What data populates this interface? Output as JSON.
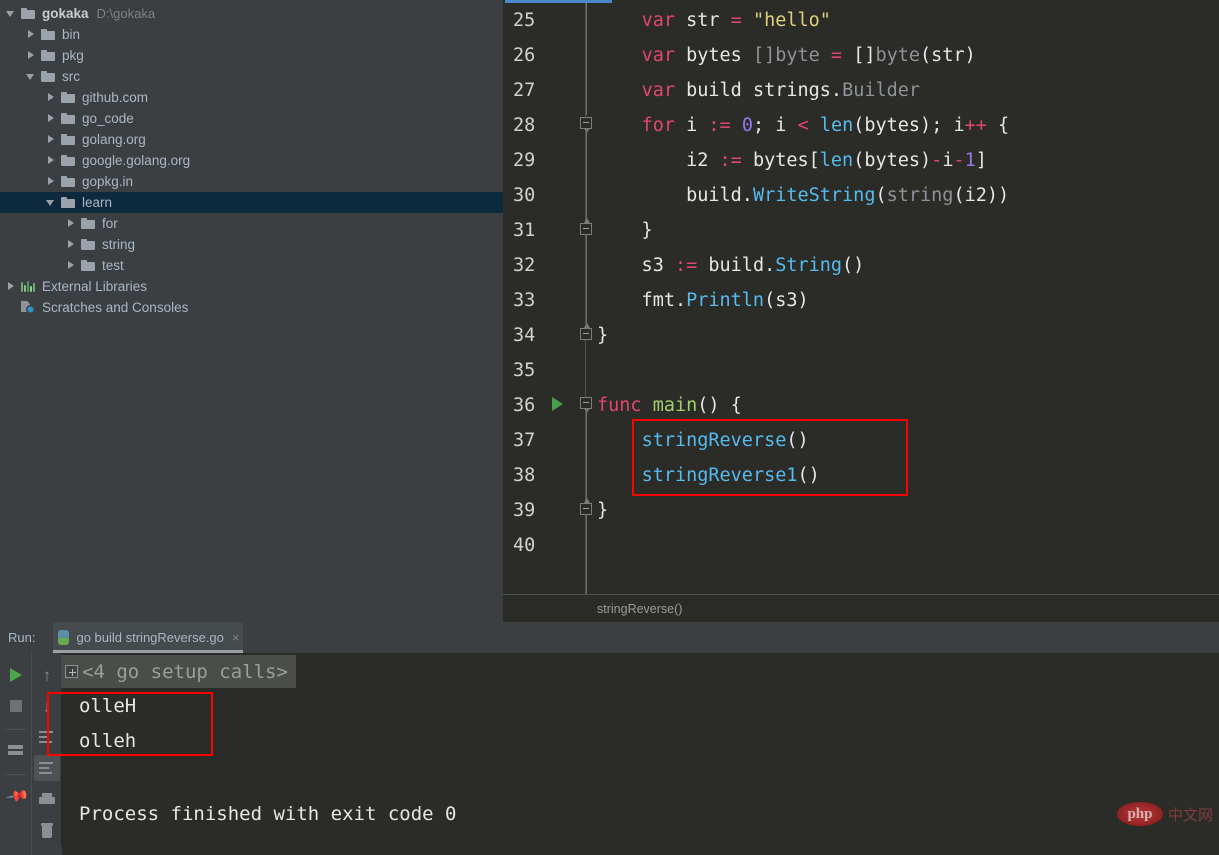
{
  "project_tree": {
    "items": [
      {
        "label": "gokaka",
        "path": "D:\\gokaka",
        "indent": 0,
        "arrow": "down",
        "icon": "folder-icon",
        "bold": true,
        "selected": false
      },
      {
        "label": "bin",
        "path": "",
        "indent": 1,
        "arrow": "right",
        "icon": "folder-icon",
        "bold": false,
        "selected": false
      },
      {
        "label": "pkg",
        "path": "",
        "indent": 1,
        "arrow": "right",
        "icon": "folder-icon",
        "bold": false,
        "selected": false
      },
      {
        "label": "src",
        "path": "",
        "indent": 1,
        "arrow": "down",
        "icon": "folder-icon",
        "bold": false,
        "selected": false
      },
      {
        "label": "github.com",
        "path": "",
        "indent": 2,
        "arrow": "right",
        "icon": "folder-icon",
        "bold": false,
        "selected": false
      },
      {
        "label": "go_code",
        "path": "",
        "indent": 2,
        "arrow": "right",
        "icon": "folder-icon",
        "bold": false,
        "selected": false
      },
      {
        "label": "golang.org",
        "path": "",
        "indent": 2,
        "arrow": "right",
        "icon": "folder-icon",
        "bold": false,
        "selected": false
      },
      {
        "label": "google.golang.org",
        "path": "",
        "indent": 2,
        "arrow": "right",
        "icon": "folder-icon",
        "bold": false,
        "selected": false
      },
      {
        "label": "gopkg.in",
        "path": "",
        "indent": 2,
        "arrow": "right",
        "icon": "folder-icon",
        "bold": false,
        "selected": false
      },
      {
        "label": "learn",
        "path": "",
        "indent": 2,
        "arrow": "down",
        "icon": "folder-icon",
        "bold": false,
        "selected": true
      },
      {
        "label": "for",
        "path": "",
        "indent": 3,
        "arrow": "right",
        "icon": "folder-icon",
        "bold": false,
        "selected": false
      },
      {
        "label": "string",
        "path": "",
        "indent": 3,
        "arrow": "right",
        "icon": "folder-icon",
        "bold": false,
        "selected": false
      },
      {
        "label": "test",
        "path": "",
        "indent": 3,
        "arrow": "right",
        "icon": "folder-icon",
        "bold": false,
        "selected": false
      },
      {
        "label": "External Libraries",
        "path": "",
        "indent": 0,
        "arrow": "right",
        "icon": "library-icon",
        "bold": false,
        "selected": false
      },
      {
        "label": "Scratches and Consoles",
        "path": "",
        "indent": 0,
        "arrow": "none",
        "icon": "scratches-icon",
        "bold": false,
        "selected": false
      }
    ]
  },
  "editor": {
    "breadcrumb": "stringReverse()",
    "lines": [
      {
        "num": "25",
        "tokens": [
          {
            "t": "    ",
            "c": "plain"
          },
          {
            "t": "var",
            "c": "kw"
          },
          {
            "t": " str ",
            "c": "plain"
          },
          {
            "t": "=",
            "c": "op"
          },
          {
            "t": " ",
            "c": "plain"
          },
          {
            "t": "\"hello\"",
            "c": "str"
          }
        ]
      },
      {
        "num": "26",
        "tokens": [
          {
            "t": "    ",
            "c": "plain"
          },
          {
            "t": "var",
            "c": "kw"
          },
          {
            "t": " bytes ",
            "c": "plain"
          },
          {
            "t": "[]byte",
            "c": "typ"
          },
          {
            "t": " ",
            "c": "plain"
          },
          {
            "t": "=",
            "c": "op"
          },
          {
            "t": " []",
            "c": "plain"
          },
          {
            "t": "byte",
            "c": "typ"
          },
          {
            "t": "(str)",
            "c": "plain"
          }
        ]
      },
      {
        "num": "27",
        "tokens": [
          {
            "t": "    ",
            "c": "plain"
          },
          {
            "t": "var",
            "c": "kw"
          },
          {
            "t": " build strings.",
            "c": "plain"
          },
          {
            "t": "Builder",
            "c": "typ"
          }
        ]
      },
      {
        "num": "28",
        "tokens": [
          {
            "t": "    ",
            "c": "plain"
          },
          {
            "t": "for",
            "c": "kw"
          },
          {
            "t": " i ",
            "c": "plain"
          },
          {
            "t": ":=",
            "c": "op"
          },
          {
            "t": " ",
            "c": "plain"
          },
          {
            "t": "0",
            "c": "num"
          },
          {
            "t": "; i ",
            "c": "plain"
          },
          {
            "t": "<",
            "c": "op"
          },
          {
            "t": " ",
            "c": "plain"
          },
          {
            "t": "len",
            "c": "call"
          },
          {
            "t": "(bytes); i",
            "c": "plain"
          },
          {
            "t": "++",
            "c": "op"
          },
          {
            "t": " {",
            "c": "plain"
          }
        ]
      },
      {
        "num": "29",
        "tokens": [
          {
            "t": "        i2 ",
            "c": "plain"
          },
          {
            "t": ":=",
            "c": "op"
          },
          {
            "t": " bytes[",
            "c": "plain"
          },
          {
            "t": "len",
            "c": "call"
          },
          {
            "t": "(bytes)",
            "c": "plain"
          },
          {
            "t": "-",
            "c": "op"
          },
          {
            "t": "i",
            "c": "plain"
          },
          {
            "t": "-",
            "c": "op"
          },
          {
            "t": "1",
            "c": "num"
          },
          {
            "t": "]",
            "c": "plain"
          }
        ]
      },
      {
        "num": "30",
        "tokens": [
          {
            "t": "        build.",
            "c": "plain"
          },
          {
            "t": "WriteString",
            "c": "call"
          },
          {
            "t": "(",
            "c": "plain"
          },
          {
            "t": "string",
            "c": "typ"
          },
          {
            "t": "(i2))",
            "c": "plain"
          }
        ]
      },
      {
        "num": "31",
        "tokens": [
          {
            "t": "    }",
            "c": "plain"
          }
        ]
      },
      {
        "num": "32",
        "tokens": [
          {
            "t": "    s3 ",
            "c": "plain"
          },
          {
            "t": ":=",
            "c": "op"
          },
          {
            "t": " build.",
            "c": "plain"
          },
          {
            "t": "String",
            "c": "call"
          },
          {
            "t": "()",
            "c": "plain"
          }
        ]
      },
      {
        "num": "33",
        "tokens": [
          {
            "t": "    fmt.",
            "c": "plain"
          },
          {
            "t": "Println",
            "c": "call"
          },
          {
            "t": "(s3)",
            "c": "plain"
          }
        ]
      },
      {
        "num": "34",
        "tokens": [
          {
            "t": "}",
            "c": "plain"
          }
        ]
      },
      {
        "num": "35",
        "tokens": []
      },
      {
        "num": "36",
        "tokens": [
          {
            "t": "func",
            "c": "kw"
          },
          {
            "t": " ",
            "c": "plain"
          },
          {
            "t": "main",
            "c": "fn"
          },
          {
            "t": "() {",
            "c": "plain"
          }
        ]
      },
      {
        "num": "37",
        "tokens": [
          {
            "t": "    ",
            "c": "plain"
          },
          {
            "t": "stringReverse",
            "c": "call"
          },
          {
            "t": "()",
            "c": "plain"
          }
        ]
      },
      {
        "num": "38",
        "tokens": [
          {
            "t": "    ",
            "c": "plain"
          },
          {
            "t": "stringReverse1",
            "c": "call"
          },
          {
            "t": "()",
            "c": "plain"
          }
        ]
      },
      {
        "num": "39",
        "tokens": [
          {
            "t": "}",
            "c": "plain"
          }
        ]
      },
      {
        "num": "40",
        "tokens": []
      }
    ]
  },
  "run_panel": {
    "run_label": "Run:",
    "tab_title": "go build stringReverse.go",
    "close_label": "×",
    "toolbar_a": [
      {
        "name": "rerun-button",
        "icon": "play-icon"
      },
      {
        "name": "stop-button",
        "icon": "stop-icon"
      },
      {
        "name": "restore-layout-button",
        "icon": "layout-icon"
      },
      {
        "name": "pin-tab-button",
        "icon": "pin-icon"
      }
    ],
    "toolbar_b": [
      {
        "name": "up-stack-button",
        "icon": "arrow-up-icon"
      },
      {
        "name": "down-stack-button",
        "icon": "arrow-down-icon"
      },
      {
        "name": "soft-wrap-button",
        "icon": "wrap-icon"
      },
      {
        "name": "scroll-to-end-button",
        "icon": "scroll-end-icon"
      },
      {
        "name": "print-button",
        "icon": "print-icon"
      },
      {
        "name": "clear-all-button",
        "icon": "trash-icon"
      }
    ],
    "console": {
      "collapsed_text": "<4 go setup calls>",
      "output_lines": [
        "olleH",
        "olleh"
      ],
      "exit_line": "Process finished with exit code 0"
    }
  },
  "watermark": {
    "badge": "php",
    "text": "中文网"
  },
  "colors": {
    "sidebar_bg": "#3c3f41",
    "editor_bg": "#2b2b28",
    "selection_bg": "#0d293e",
    "tab_accent": "#4a88c7",
    "highlight_box": "#ff0000",
    "keyword": "#e2466d",
    "string": "#dfd179",
    "function": "#a2cf6e",
    "call": "#55bbee",
    "type": "#8d9399",
    "number": "#9876ee"
  }
}
